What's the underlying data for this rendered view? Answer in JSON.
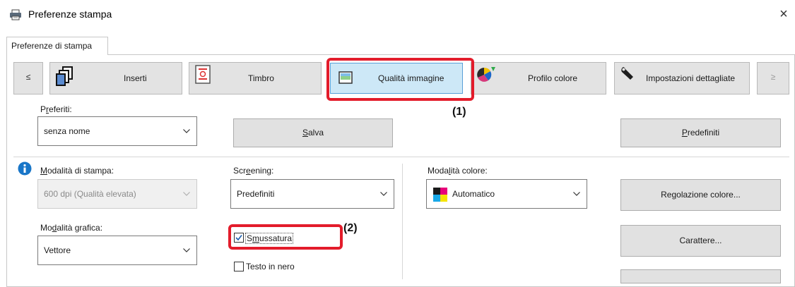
{
  "window": {
    "title": "Preferenze stampa",
    "close_glyph": "×",
    "title_icon": "printer-icon"
  },
  "tabs": [
    {
      "label": "Preferenze di stampa",
      "selected": true
    }
  ],
  "toolbar": {
    "prev_glyph": "≤",
    "next_glyph": "≥",
    "items": [
      {
        "label": "Inserti",
        "icon": "inserts-icon"
      },
      {
        "label": "Timbro",
        "icon": "stamp-icon"
      },
      {
        "label": "Qualità immagine",
        "icon": "image-quality-icon",
        "selected": true
      },
      {
        "label": "Profilo colore",
        "icon": "color-profile-icon"
      },
      {
        "label": "Impostazioni dettagliate",
        "icon": "wrench-icon"
      }
    ]
  },
  "favorites": {
    "label_pre": "P",
    "label_u": "r",
    "label_post": "eferiti:",
    "value": "senza nome",
    "save_pre": "",
    "save_u": "S",
    "save_post": "alva",
    "defaults_pre": "",
    "defaults_u": "P",
    "defaults_post": "redefiniti"
  },
  "print_mode": {
    "label_u": "M",
    "label_post": "odalità di stampa:",
    "value": "600 dpi (Qualità elevata)",
    "icon": "info-icon"
  },
  "screening": {
    "label_pre": "Scr",
    "label_u": "e",
    "label_post": "ening:",
    "value": "Predefiniti"
  },
  "color_mode": {
    "label_pre": "Moda",
    "label_u": "l",
    "label_post": "ità colore:",
    "value": "Automatico",
    "icon": "color-swatch-icon"
  },
  "graphics_mode": {
    "label_pre": "Mo",
    "label_u": "d",
    "label_post": "alità grafica:",
    "value": "Vettore"
  },
  "smoothing": {
    "label_pre": "S",
    "label_u": "m",
    "label_post": "ussatura",
    "checked": true
  },
  "black_text": {
    "label": "Testo in nero",
    "checked": false
  },
  "color_adjust": {
    "label_pre": "Re",
    "label_u": "g",
    "label_post": "olazione colore..."
  },
  "character": {
    "label": "Carattere..."
  },
  "callouts": {
    "one": "(1)",
    "two": "(2)"
  },
  "colors": {
    "highlight": "#e31c2b",
    "selected_tab": "#cde8f7",
    "button_face": "#e1e1e1"
  }
}
